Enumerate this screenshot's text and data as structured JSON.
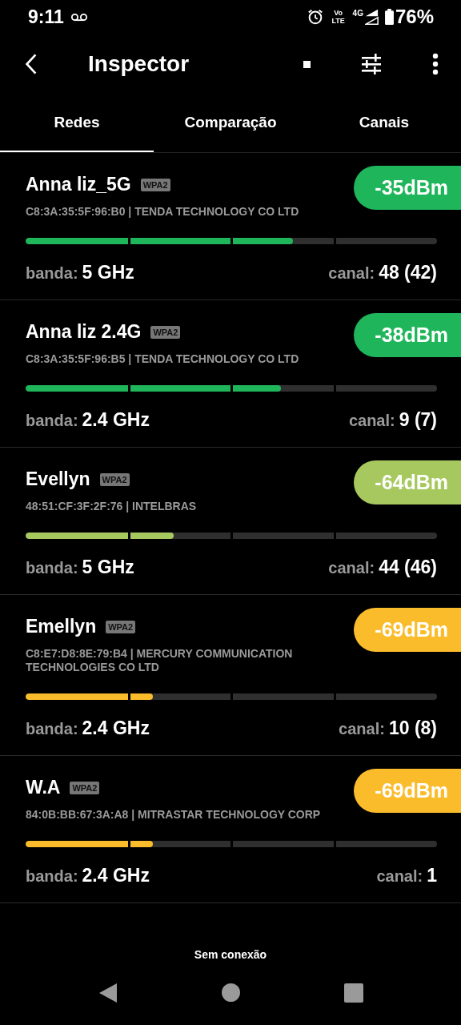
{
  "status_bar": {
    "time": "9:11",
    "volte": "Vo LTE",
    "network_type": "4G",
    "battery": "76%"
  },
  "app_bar": {
    "title": "Inspector"
  },
  "tabs": [
    {
      "label": "Redes",
      "selected": true
    },
    {
      "label": "Comparação",
      "selected": false
    },
    {
      "label": "Canais",
      "selected": false
    }
  ],
  "networks": [
    {
      "ssid": "Anna liz_5G",
      "security": "WPA2",
      "mac_vendor": "C8:3A:35:5F:96:B0  | TENDA TECHNOLOGY CO LTD",
      "signal": "-35dBm",
      "color": "#1fb55a",
      "level": 0.65,
      "band_label": "banda:",
      "band": "5 GHz",
      "channel_label": "canal:",
      "channel": "48 (42)"
    },
    {
      "ssid": "Anna liz 2.4G",
      "security": "WPA2",
      "mac_vendor": "C8:3A:35:5F:96:B5  | TENDA TECHNOLOGY CO LTD",
      "signal": "-38dBm",
      "color": "#1fb55a",
      "level": 0.62,
      "band_label": "banda:",
      "band": "2.4 GHz",
      "channel_label": "canal:",
      "channel": "9 (7)"
    },
    {
      "ssid": "Evellyn",
      "security": "WPA2",
      "mac_vendor": "48:51:CF:3F:2F:76  | INTELBRAS",
      "signal": "-64dBm",
      "color": "#a6c85e",
      "level": 0.36,
      "band_label": "banda:",
      "band": "5 GHz",
      "channel_label": "canal:",
      "channel": "44 (46)"
    },
    {
      "ssid": "Emellyn",
      "security": "WPA2",
      "mac_vendor": "C8:E7:D8:8E:79:B4  | MERCURY COMMUNICATION TECHNOLOGIES CO LTD",
      "signal": "-69dBm",
      "color": "#fbbc2c",
      "level": 0.31,
      "band_label": "banda:",
      "band": "2.4 GHz",
      "channel_label": "canal:",
      "channel": "10 (8)"
    },
    {
      "ssid": "W.A",
      "security": "WPA2",
      "mac_vendor": "84:0B:BB:67:3A:A8  | MITRASTAR TECHNOLOGY CORP",
      "signal": "-69dBm",
      "color": "#fbbc2c",
      "level": 0.31,
      "band_label": "banda:",
      "band": "2.4 GHz",
      "channel_label": "canal:",
      "channel": "1"
    }
  ],
  "connection_status": "Sem conexão"
}
